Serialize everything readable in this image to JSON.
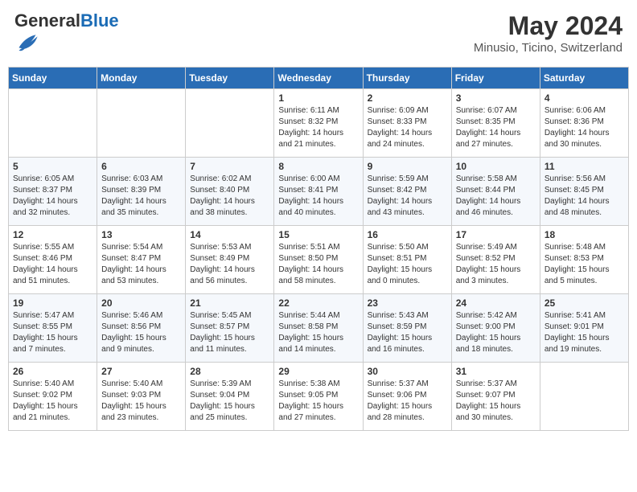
{
  "header": {
    "title": "May 2024",
    "location": "Minusio, Ticino, Switzerland",
    "logo_general": "General",
    "logo_blue": "Blue"
  },
  "days_of_week": [
    "Sunday",
    "Monday",
    "Tuesday",
    "Wednesday",
    "Thursday",
    "Friday",
    "Saturday"
  ],
  "weeks": [
    [
      {
        "day": null,
        "info": null
      },
      {
        "day": null,
        "info": null
      },
      {
        "day": null,
        "info": null
      },
      {
        "day": "1",
        "info": "Sunrise: 6:11 AM\nSunset: 8:32 PM\nDaylight: 14 hours\nand 21 minutes."
      },
      {
        "day": "2",
        "info": "Sunrise: 6:09 AM\nSunset: 8:33 PM\nDaylight: 14 hours\nand 24 minutes."
      },
      {
        "day": "3",
        "info": "Sunrise: 6:07 AM\nSunset: 8:35 PM\nDaylight: 14 hours\nand 27 minutes."
      },
      {
        "day": "4",
        "info": "Sunrise: 6:06 AM\nSunset: 8:36 PM\nDaylight: 14 hours\nand 30 minutes."
      }
    ],
    [
      {
        "day": "5",
        "info": "Sunrise: 6:05 AM\nSunset: 8:37 PM\nDaylight: 14 hours\nand 32 minutes."
      },
      {
        "day": "6",
        "info": "Sunrise: 6:03 AM\nSunset: 8:39 PM\nDaylight: 14 hours\nand 35 minutes."
      },
      {
        "day": "7",
        "info": "Sunrise: 6:02 AM\nSunset: 8:40 PM\nDaylight: 14 hours\nand 38 minutes."
      },
      {
        "day": "8",
        "info": "Sunrise: 6:00 AM\nSunset: 8:41 PM\nDaylight: 14 hours\nand 40 minutes."
      },
      {
        "day": "9",
        "info": "Sunrise: 5:59 AM\nSunset: 8:42 PM\nDaylight: 14 hours\nand 43 minutes."
      },
      {
        "day": "10",
        "info": "Sunrise: 5:58 AM\nSunset: 8:44 PM\nDaylight: 14 hours\nand 46 minutes."
      },
      {
        "day": "11",
        "info": "Sunrise: 5:56 AM\nSunset: 8:45 PM\nDaylight: 14 hours\nand 48 minutes."
      }
    ],
    [
      {
        "day": "12",
        "info": "Sunrise: 5:55 AM\nSunset: 8:46 PM\nDaylight: 14 hours\nand 51 minutes."
      },
      {
        "day": "13",
        "info": "Sunrise: 5:54 AM\nSunset: 8:47 PM\nDaylight: 14 hours\nand 53 minutes."
      },
      {
        "day": "14",
        "info": "Sunrise: 5:53 AM\nSunset: 8:49 PM\nDaylight: 14 hours\nand 56 minutes."
      },
      {
        "day": "15",
        "info": "Sunrise: 5:51 AM\nSunset: 8:50 PM\nDaylight: 14 hours\nand 58 minutes."
      },
      {
        "day": "16",
        "info": "Sunrise: 5:50 AM\nSunset: 8:51 PM\nDaylight: 15 hours\nand 0 minutes."
      },
      {
        "day": "17",
        "info": "Sunrise: 5:49 AM\nSunset: 8:52 PM\nDaylight: 15 hours\nand 3 minutes."
      },
      {
        "day": "18",
        "info": "Sunrise: 5:48 AM\nSunset: 8:53 PM\nDaylight: 15 hours\nand 5 minutes."
      }
    ],
    [
      {
        "day": "19",
        "info": "Sunrise: 5:47 AM\nSunset: 8:55 PM\nDaylight: 15 hours\nand 7 minutes."
      },
      {
        "day": "20",
        "info": "Sunrise: 5:46 AM\nSunset: 8:56 PM\nDaylight: 15 hours\nand 9 minutes."
      },
      {
        "day": "21",
        "info": "Sunrise: 5:45 AM\nSunset: 8:57 PM\nDaylight: 15 hours\nand 11 minutes."
      },
      {
        "day": "22",
        "info": "Sunrise: 5:44 AM\nSunset: 8:58 PM\nDaylight: 15 hours\nand 14 minutes."
      },
      {
        "day": "23",
        "info": "Sunrise: 5:43 AM\nSunset: 8:59 PM\nDaylight: 15 hours\nand 16 minutes."
      },
      {
        "day": "24",
        "info": "Sunrise: 5:42 AM\nSunset: 9:00 PM\nDaylight: 15 hours\nand 18 minutes."
      },
      {
        "day": "25",
        "info": "Sunrise: 5:41 AM\nSunset: 9:01 PM\nDaylight: 15 hours\nand 19 minutes."
      }
    ],
    [
      {
        "day": "26",
        "info": "Sunrise: 5:40 AM\nSunset: 9:02 PM\nDaylight: 15 hours\nand 21 minutes."
      },
      {
        "day": "27",
        "info": "Sunrise: 5:40 AM\nSunset: 9:03 PM\nDaylight: 15 hours\nand 23 minutes."
      },
      {
        "day": "28",
        "info": "Sunrise: 5:39 AM\nSunset: 9:04 PM\nDaylight: 15 hours\nand 25 minutes."
      },
      {
        "day": "29",
        "info": "Sunrise: 5:38 AM\nSunset: 9:05 PM\nDaylight: 15 hours\nand 27 minutes."
      },
      {
        "day": "30",
        "info": "Sunrise: 5:37 AM\nSunset: 9:06 PM\nDaylight: 15 hours\nand 28 minutes."
      },
      {
        "day": "31",
        "info": "Sunrise: 5:37 AM\nSunset: 9:07 PM\nDaylight: 15 hours\nand 30 minutes."
      },
      {
        "day": null,
        "info": null
      }
    ]
  ]
}
